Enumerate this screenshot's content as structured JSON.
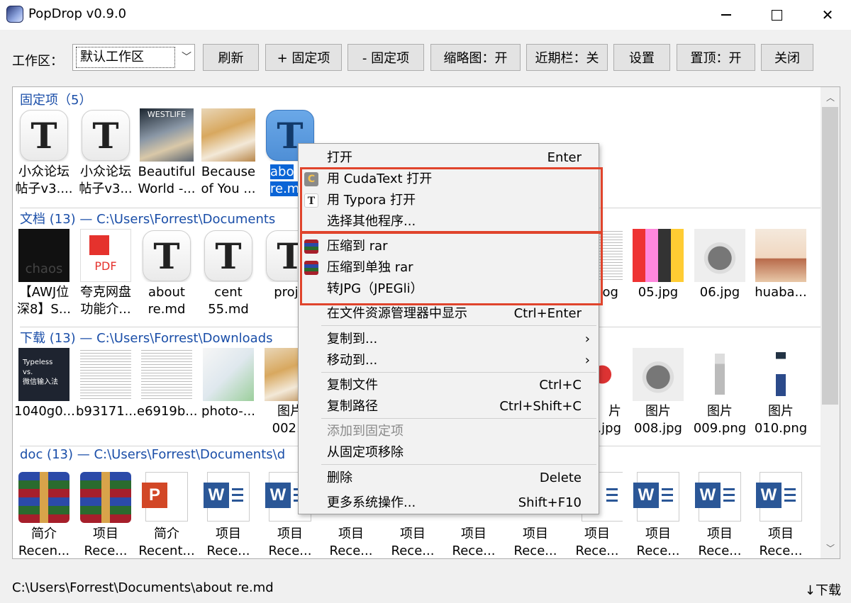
{
  "window": {
    "title": "PopDrop v0.9.0"
  },
  "toolbar": {
    "workspace_label": "工作区：",
    "workspace_value": "默认工作区",
    "buttons": [
      "刷新",
      "+ 固定项",
      "- 固定项",
      "缩略图：开",
      "近期栏：关",
      "设置",
      "置顶：开",
      "关闭"
    ]
  },
  "sections": {
    "pinned": {
      "title": "固定项（5）",
      "items": [
        "小众论坛\n帖子v3....",
        "小众论坛\n帖子v3...",
        "Beautiful\nWorld -...",
        "Because\nof You ...",
        "abo\nre.m"
      ]
    },
    "docs": {
      "title": "文档 (13) — C:\\Users\\Forrest\\Documents",
      "items": [
        "【AWJ位\n深8】S...",
        "夸克网盘\n功能介...",
        "about\nre.md",
        "cent\n55.md",
        "proje",
        "og",
        "05.jpg",
        "06.jpg",
        "huaba..."
      ]
    },
    "downloads": {
      "title": "下载 (13) — C:\\Users\\Forrest\\Downloads",
      "items": [
        "1040g0...",
        "b93171...",
        "e6919b...",
        "photo-...",
        "图片\n002.v",
        "片\n.jpg",
        "图片\n008.jpg",
        "图片\n009.png",
        "图片\n010.png"
      ]
    },
    "doc": {
      "title": "doc (13) — C:\\Users\\Forrest\\Documents\\d",
      "items": [
        "简介\nRecen...",
        "项目\nRece...",
        "简介\nRecent...",
        "项目\nRece...",
        "项目\nRece...",
        "项目\nRece...",
        "项目\nRece...",
        "项目\nRece...",
        "项目\nRece...",
        "项目\nRece...",
        "项目\nRece...",
        "项目\nRece...",
        "项目\nRece..."
      ]
    }
  },
  "thumb_text": {
    "awj": "chaos",
    "pdf": "PDF",
    "typeless": "Typeless\nvs.\n微信输入法",
    "westlife": "WESTLIFE",
    "w": "W",
    "p": "P",
    "t": "T"
  },
  "menu": {
    "open": {
      "label": "打开",
      "shortcut": "Enter"
    },
    "open_cudatext": "用 CudaText 打开",
    "open_typora": "用 Typora 打开",
    "choose_other": "选择其他程序...",
    "compress_rar": "压缩到 rar",
    "compress_single_rar": "压缩到单独 rar",
    "to_jpg": "转JPG（JPEGli）",
    "show_in_explorer": {
      "label": "在文件资源管理器中显示",
      "shortcut": "Ctrl+Enter"
    },
    "copy_to": {
      "label": "复制到...",
      "arrow": "›"
    },
    "move_to": {
      "label": "移动到...",
      "arrow": "›"
    },
    "copy_file": {
      "label": "复制文件",
      "shortcut": "Ctrl+C"
    },
    "copy_path": {
      "label": "复制路径",
      "shortcut": "Ctrl+Shift+C"
    },
    "add_pin": "添加到固定项",
    "remove_pin": "从固定项移除",
    "delete": {
      "label": "删除",
      "shortcut": "Delete"
    },
    "more": {
      "label": "更多系统操作...",
      "shortcut": "Shift+F10"
    },
    "icons": {
      "cudatext": "C",
      "typora": "T"
    }
  },
  "status": {
    "path": "C:\\Users\\Forrest\\Documents\\about re.md",
    "right": "↓下载"
  },
  "colors": {
    "accent": "#0a64d6",
    "section_header": "#1a4ea8",
    "highlight_box": "#e0442c"
  }
}
